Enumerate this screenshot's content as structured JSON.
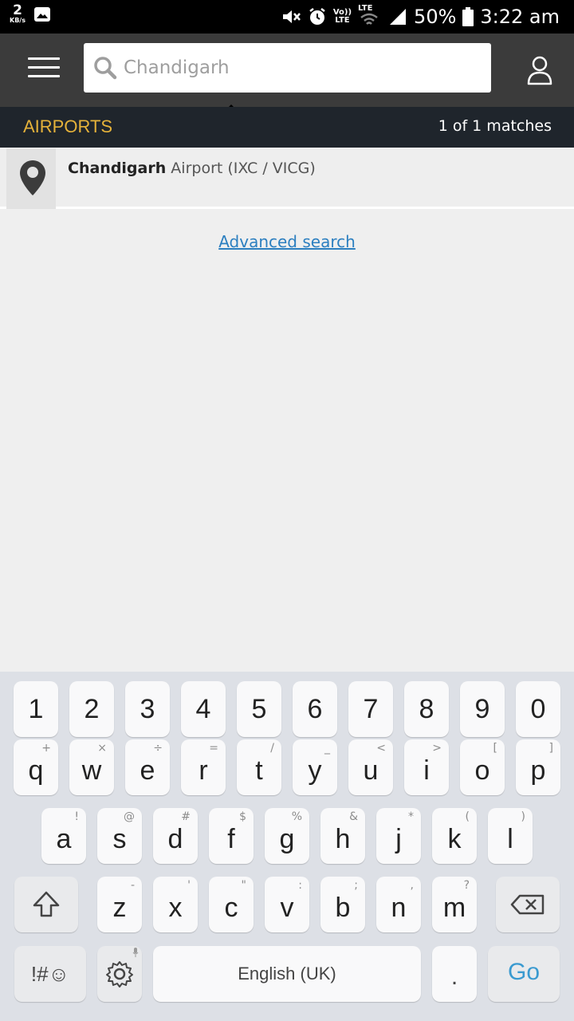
{
  "status_bar": {
    "data_rate": "2",
    "data_unit": "KB/s",
    "volte_label_top": "Vo))",
    "volte_label_bottom": "LTE",
    "lte_label": "LTE",
    "battery": "50%",
    "time": "3:22 am"
  },
  "header": {
    "search_value": "Chandigarh"
  },
  "subheader": {
    "title": "AIRPORTS",
    "match_count": "1 of 1 matches"
  },
  "results": [
    {
      "name_bold": "Chandigarh",
      "rest": " Airport (IXC / VICG)"
    }
  ],
  "advanced_search": "Advanced search",
  "keyboard": {
    "numbers": [
      "1",
      "2",
      "3",
      "4",
      "5",
      "6",
      "7",
      "8",
      "9",
      "0"
    ],
    "row1": [
      {
        "k": "q",
        "h": "+"
      },
      {
        "k": "w",
        "h": "×"
      },
      {
        "k": "e",
        "h": "÷"
      },
      {
        "k": "r",
        "h": "="
      },
      {
        "k": "t",
        "h": "/"
      },
      {
        "k": "y",
        "h": "_"
      },
      {
        "k": "u",
        "h": "<"
      },
      {
        "k": "i",
        "h": ">"
      },
      {
        "k": "o",
        "h": "["
      },
      {
        "k": "p",
        "h": "]"
      }
    ],
    "row2": [
      {
        "k": "a",
        "h": "!"
      },
      {
        "k": "s",
        "h": "@"
      },
      {
        "k": "d",
        "h": "#"
      },
      {
        "k": "f",
        "h": "$"
      },
      {
        "k": "g",
        "h": "%"
      },
      {
        "k": "h",
        "h": "&"
      },
      {
        "k": "j",
        "h": "*"
      },
      {
        "k": "k",
        "h": "("
      },
      {
        "k": "l",
        "h": ")"
      }
    ],
    "row3": [
      {
        "k": "z",
        "h": "-"
      },
      {
        "k": "x",
        "h": "'"
      },
      {
        "k": "c",
        "h": "\""
      },
      {
        "k": "v",
        "h": ":"
      },
      {
        "k": "b",
        "h": ";"
      },
      {
        "k": "n",
        "h": ","
      },
      {
        "k": "m",
        "h": "?"
      }
    ],
    "symbols_label": "!#☺",
    "space_label": "English (UK)",
    "period_label": ".",
    "go_label": "Go"
  },
  "colors": {
    "header_bg": "#3b3b3b",
    "subheader_bg": "#1f252c",
    "accent_yellow": "#e5b23a",
    "link_blue": "#2c7fc0",
    "go_blue": "#3a9ad0"
  }
}
